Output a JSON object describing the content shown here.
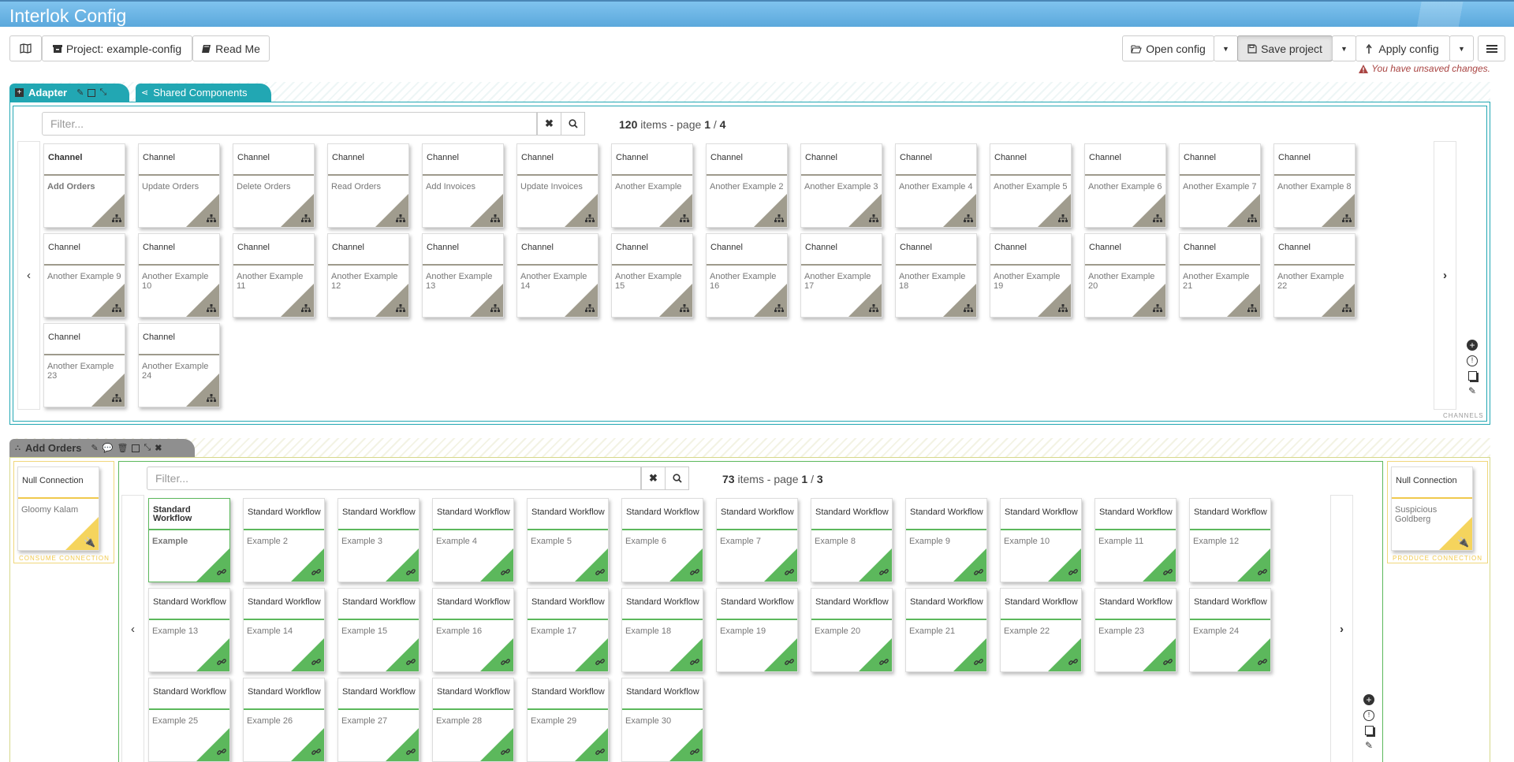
{
  "app": {
    "title": "Interlok Config"
  },
  "toolbar": {
    "project_label": "Project: example-config",
    "readme_label": "Read Me",
    "open_config_label": "Open config",
    "save_project_label": "Save project",
    "apply_config_label": "Apply config",
    "unsaved_message": "You have unsaved changes."
  },
  "tabs": {
    "adapter": "Adapter",
    "shared": "Shared Components"
  },
  "channels": {
    "filter_placeholder": "Filter...",
    "count": "120",
    "count_text": "items - page",
    "page": "1",
    "page_sep": "/",
    "pages": "4",
    "side_label": "CHANNELS",
    "items": [
      {
        "type": "Channel",
        "name": "Add Orders"
      },
      {
        "type": "Channel",
        "name": "Update Orders"
      },
      {
        "type": "Channel",
        "name": "Delete Orders"
      },
      {
        "type": "Channel",
        "name": "Read Orders"
      },
      {
        "type": "Channel",
        "name": "Add Invoices"
      },
      {
        "type": "Channel",
        "name": "Update Invoices"
      },
      {
        "type": "Channel",
        "name": "Another Example"
      },
      {
        "type": "Channel",
        "name": "Another Example 2"
      },
      {
        "type": "Channel",
        "name": "Another Example 3"
      },
      {
        "type": "Channel",
        "name": "Another Example 4"
      },
      {
        "type": "Channel",
        "name": "Another Example 5"
      },
      {
        "type": "Channel",
        "name": "Another Example 6"
      },
      {
        "type": "Channel",
        "name": "Another Example 7"
      },
      {
        "type": "Channel",
        "name": "Another Example 8"
      },
      {
        "type": "Channel",
        "name": "Another Example 9"
      },
      {
        "type": "Channel",
        "name": "Another Example 10"
      },
      {
        "type": "Channel",
        "name": "Another Example 11"
      },
      {
        "type": "Channel",
        "name": "Another Example 12"
      },
      {
        "type": "Channel",
        "name": "Another Example 13"
      },
      {
        "type": "Channel",
        "name": "Another Example 14"
      },
      {
        "type": "Channel",
        "name": "Another Example 15"
      },
      {
        "type": "Channel",
        "name": "Another Example 16"
      },
      {
        "type": "Channel",
        "name": "Another Example 17"
      },
      {
        "type": "Channel",
        "name": "Another Example 18"
      },
      {
        "type": "Channel",
        "name": "Another Example 19"
      },
      {
        "type": "Channel",
        "name": "Another Example 20"
      },
      {
        "type": "Channel",
        "name": "Another Example 21"
      },
      {
        "type": "Channel",
        "name": "Another Example 22"
      },
      {
        "type": "Channel",
        "name": "Another Example 23"
      },
      {
        "type": "Channel",
        "name": "Another Example 24"
      }
    ]
  },
  "channel_detail": {
    "title": "Add Orders",
    "consume": {
      "type": "Null Connection",
      "name": "Gloomy Kalam",
      "label": "CONSUME CONNECTION"
    },
    "produce": {
      "type": "Null Connection",
      "name": "Suspicious Goldberg",
      "label": "PRODUCE CONNECTION"
    },
    "filter_placeholder": "Filter...",
    "count": "73",
    "count_text": "items - page",
    "page": "1",
    "page_sep": "/",
    "pages": "3",
    "workflows": [
      {
        "type": "Standard Workflow",
        "name": "Example"
      },
      {
        "type": "Standard Workflow",
        "name": "Example 2"
      },
      {
        "type": "Standard Workflow",
        "name": "Example 3"
      },
      {
        "type": "Standard Workflow",
        "name": "Example 4"
      },
      {
        "type": "Standard Workflow",
        "name": "Example 5"
      },
      {
        "type": "Standard Workflow",
        "name": "Example 6"
      },
      {
        "type": "Standard Workflow",
        "name": "Example 7"
      },
      {
        "type": "Standard Workflow",
        "name": "Example 8"
      },
      {
        "type": "Standard Workflow",
        "name": "Example 9"
      },
      {
        "type": "Standard Workflow",
        "name": "Example 10"
      },
      {
        "type": "Standard Workflow",
        "name": "Example 11"
      },
      {
        "type": "Standard Workflow",
        "name": "Example 12"
      },
      {
        "type": "Standard Workflow",
        "name": "Example 13"
      },
      {
        "type": "Standard Workflow",
        "name": "Example 14"
      },
      {
        "type": "Standard Workflow",
        "name": "Example 15"
      },
      {
        "type": "Standard Workflow",
        "name": "Example 16"
      },
      {
        "type": "Standard Workflow",
        "name": "Example 17"
      },
      {
        "type": "Standard Workflow",
        "name": "Example 18"
      },
      {
        "type": "Standard Workflow",
        "name": "Example 19"
      },
      {
        "type": "Standard Workflow",
        "name": "Example 20"
      },
      {
        "type": "Standard Workflow",
        "name": "Example 21"
      },
      {
        "type": "Standard Workflow",
        "name": "Example 22"
      },
      {
        "type": "Standard Workflow",
        "name": "Example 23"
      },
      {
        "type": "Standard Workflow",
        "name": "Example 24"
      },
      {
        "type": "Standard Workflow",
        "name": "Example 25"
      },
      {
        "type": "Standard Workflow",
        "name": "Example 26"
      },
      {
        "type": "Standard Workflow",
        "name": "Example 27"
      },
      {
        "type": "Standard Workflow",
        "name": "Example 28"
      },
      {
        "type": "Standard Workflow",
        "name": "Example 29"
      },
      {
        "type": "Standard Workflow",
        "name": "Example 30"
      }
    ]
  },
  "colors": {
    "accent": "#22a7b3",
    "channel": "#a09c8e",
    "workflow": "#5cb85c",
    "connection": "#f5d45d",
    "warning": "#a94442"
  }
}
